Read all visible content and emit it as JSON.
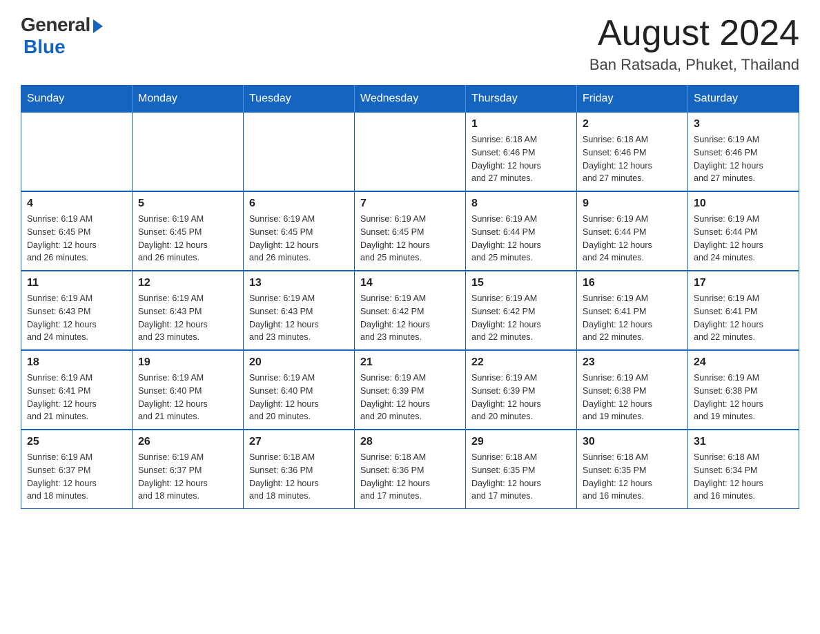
{
  "logo": {
    "general": "General",
    "blue": "Blue"
  },
  "header": {
    "month_year": "August 2024",
    "location": "Ban Ratsada, Phuket, Thailand"
  },
  "weekdays": [
    "Sunday",
    "Monday",
    "Tuesday",
    "Wednesday",
    "Thursday",
    "Friday",
    "Saturday"
  ],
  "weeks": [
    [
      {
        "day": "",
        "info": ""
      },
      {
        "day": "",
        "info": ""
      },
      {
        "day": "",
        "info": ""
      },
      {
        "day": "",
        "info": ""
      },
      {
        "day": "1",
        "info": "Sunrise: 6:18 AM\nSunset: 6:46 PM\nDaylight: 12 hours\nand 27 minutes."
      },
      {
        "day": "2",
        "info": "Sunrise: 6:18 AM\nSunset: 6:46 PM\nDaylight: 12 hours\nand 27 minutes."
      },
      {
        "day": "3",
        "info": "Sunrise: 6:19 AM\nSunset: 6:46 PM\nDaylight: 12 hours\nand 27 minutes."
      }
    ],
    [
      {
        "day": "4",
        "info": "Sunrise: 6:19 AM\nSunset: 6:45 PM\nDaylight: 12 hours\nand 26 minutes."
      },
      {
        "day": "5",
        "info": "Sunrise: 6:19 AM\nSunset: 6:45 PM\nDaylight: 12 hours\nand 26 minutes."
      },
      {
        "day": "6",
        "info": "Sunrise: 6:19 AM\nSunset: 6:45 PM\nDaylight: 12 hours\nand 26 minutes."
      },
      {
        "day": "7",
        "info": "Sunrise: 6:19 AM\nSunset: 6:45 PM\nDaylight: 12 hours\nand 25 minutes."
      },
      {
        "day": "8",
        "info": "Sunrise: 6:19 AM\nSunset: 6:44 PM\nDaylight: 12 hours\nand 25 minutes."
      },
      {
        "day": "9",
        "info": "Sunrise: 6:19 AM\nSunset: 6:44 PM\nDaylight: 12 hours\nand 24 minutes."
      },
      {
        "day": "10",
        "info": "Sunrise: 6:19 AM\nSunset: 6:44 PM\nDaylight: 12 hours\nand 24 minutes."
      }
    ],
    [
      {
        "day": "11",
        "info": "Sunrise: 6:19 AM\nSunset: 6:43 PM\nDaylight: 12 hours\nand 24 minutes."
      },
      {
        "day": "12",
        "info": "Sunrise: 6:19 AM\nSunset: 6:43 PM\nDaylight: 12 hours\nand 23 minutes."
      },
      {
        "day": "13",
        "info": "Sunrise: 6:19 AM\nSunset: 6:43 PM\nDaylight: 12 hours\nand 23 minutes."
      },
      {
        "day": "14",
        "info": "Sunrise: 6:19 AM\nSunset: 6:42 PM\nDaylight: 12 hours\nand 23 minutes."
      },
      {
        "day": "15",
        "info": "Sunrise: 6:19 AM\nSunset: 6:42 PM\nDaylight: 12 hours\nand 22 minutes."
      },
      {
        "day": "16",
        "info": "Sunrise: 6:19 AM\nSunset: 6:41 PM\nDaylight: 12 hours\nand 22 minutes."
      },
      {
        "day": "17",
        "info": "Sunrise: 6:19 AM\nSunset: 6:41 PM\nDaylight: 12 hours\nand 22 minutes."
      }
    ],
    [
      {
        "day": "18",
        "info": "Sunrise: 6:19 AM\nSunset: 6:41 PM\nDaylight: 12 hours\nand 21 minutes."
      },
      {
        "day": "19",
        "info": "Sunrise: 6:19 AM\nSunset: 6:40 PM\nDaylight: 12 hours\nand 21 minutes."
      },
      {
        "day": "20",
        "info": "Sunrise: 6:19 AM\nSunset: 6:40 PM\nDaylight: 12 hours\nand 20 minutes."
      },
      {
        "day": "21",
        "info": "Sunrise: 6:19 AM\nSunset: 6:39 PM\nDaylight: 12 hours\nand 20 minutes."
      },
      {
        "day": "22",
        "info": "Sunrise: 6:19 AM\nSunset: 6:39 PM\nDaylight: 12 hours\nand 20 minutes."
      },
      {
        "day": "23",
        "info": "Sunrise: 6:19 AM\nSunset: 6:38 PM\nDaylight: 12 hours\nand 19 minutes."
      },
      {
        "day": "24",
        "info": "Sunrise: 6:19 AM\nSunset: 6:38 PM\nDaylight: 12 hours\nand 19 minutes."
      }
    ],
    [
      {
        "day": "25",
        "info": "Sunrise: 6:19 AM\nSunset: 6:37 PM\nDaylight: 12 hours\nand 18 minutes."
      },
      {
        "day": "26",
        "info": "Sunrise: 6:19 AM\nSunset: 6:37 PM\nDaylight: 12 hours\nand 18 minutes."
      },
      {
        "day": "27",
        "info": "Sunrise: 6:18 AM\nSunset: 6:36 PM\nDaylight: 12 hours\nand 18 minutes."
      },
      {
        "day": "28",
        "info": "Sunrise: 6:18 AM\nSunset: 6:36 PM\nDaylight: 12 hours\nand 17 minutes."
      },
      {
        "day": "29",
        "info": "Sunrise: 6:18 AM\nSunset: 6:35 PM\nDaylight: 12 hours\nand 17 minutes."
      },
      {
        "day": "30",
        "info": "Sunrise: 6:18 AM\nSunset: 6:35 PM\nDaylight: 12 hours\nand 16 minutes."
      },
      {
        "day": "31",
        "info": "Sunrise: 6:18 AM\nSunset: 6:34 PM\nDaylight: 12 hours\nand 16 minutes."
      }
    ]
  ]
}
